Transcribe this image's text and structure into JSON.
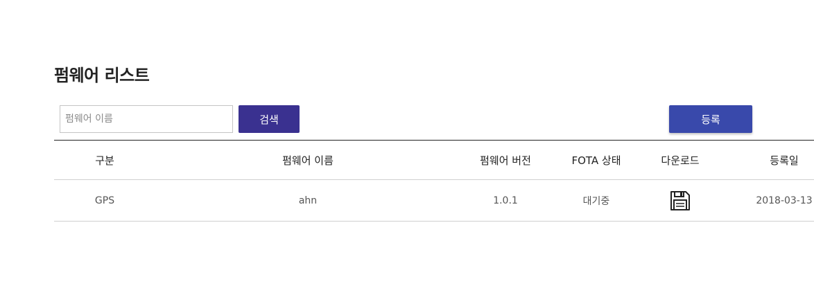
{
  "header": {
    "title": "펌웨어 리스트"
  },
  "search": {
    "placeholder": "펌웨어 이름",
    "value": "",
    "button_label": "검색"
  },
  "actions": {
    "register_label": "등록"
  },
  "table": {
    "columns": [
      "구분",
      "펌웨어 이름",
      "펌웨어 버전",
      "FOTA 상태",
      "다운로드",
      "등록일"
    ],
    "rows": [
      {
        "type": "GPS",
        "name": "ahn",
        "version": "1.0.1",
        "fota_status": "대기중",
        "download_icon": "save-icon",
        "registered_date": "2018-03-13"
      }
    ]
  },
  "colors": {
    "search_button": "#3a3190",
    "register_button": "#3949ab",
    "header_border": "#222222",
    "row_border": "#cfcfcf"
  }
}
